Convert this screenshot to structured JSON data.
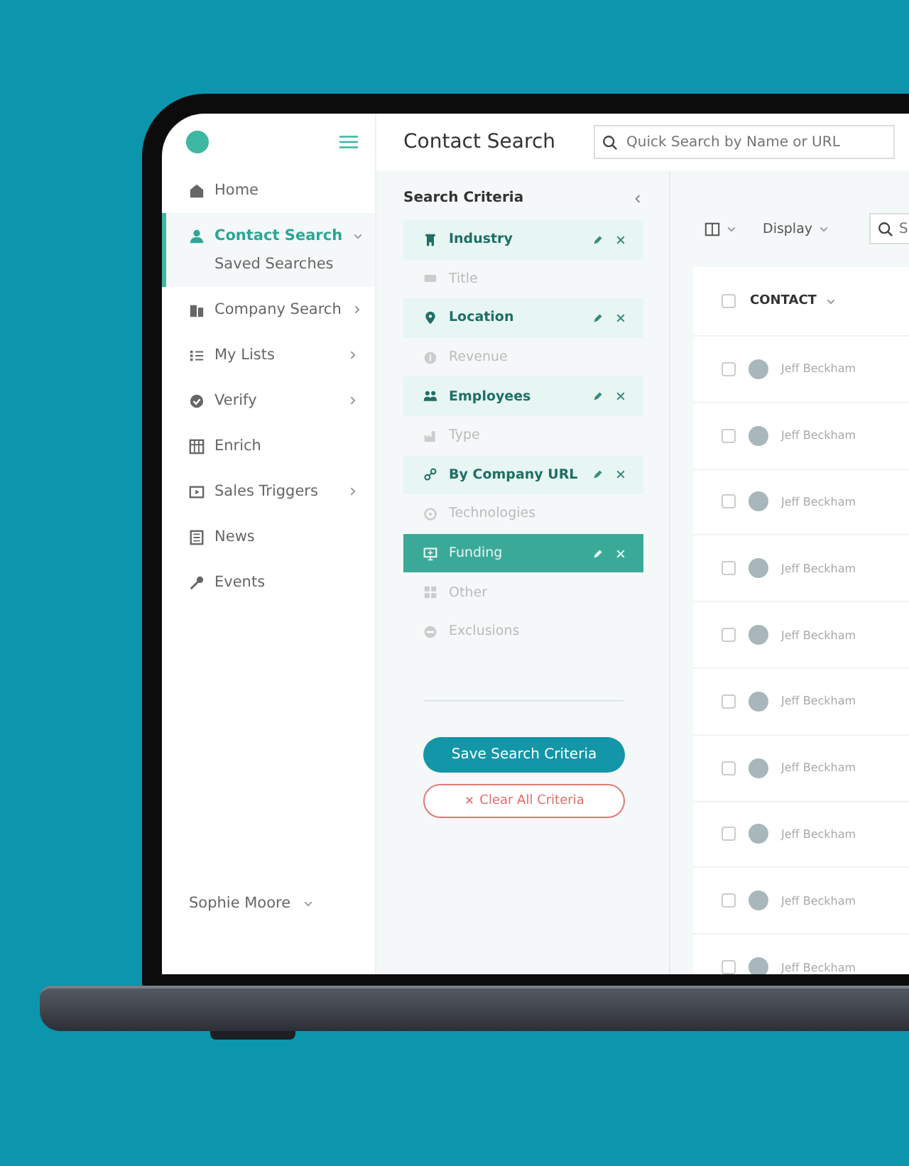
{
  "header": {
    "title": "Contact Search",
    "search": {
      "placeholder": "Quick Search by Name or URL"
    }
  },
  "sidebar": {
    "items": [
      {
        "label": "Home",
        "kind": "link",
        "selected": false
      },
      {
        "label": "Contact Search",
        "kind": "group",
        "selected": true,
        "expanded": true,
        "children": [
          {
            "label": "Saved Searches",
            "selected": false
          }
        ]
      },
      {
        "label": "Company Search",
        "kind": "group",
        "selected": false,
        "expanded": false
      },
      {
        "label": "My Lists",
        "kind": "group",
        "selected": false,
        "expanded": false
      },
      {
        "label": "Verify",
        "kind": "group",
        "selected": false,
        "expanded": false
      },
      {
        "label": "Enrich",
        "kind": "link",
        "selected": false
      },
      {
        "label": "Sales Triggers",
        "kind": "group",
        "selected": false,
        "expanded": false
      },
      {
        "label": "News",
        "kind": "link",
        "selected": false
      },
      {
        "label": "Events",
        "kind": "link",
        "selected": false
      }
    ],
    "user": "Sophie Moore"
  },
  "criteria": {
    "title": "Search Criteria",
    "items": [
      {
        "label": "Industry",
        "active": true,
        "selected": false
      },
      {
        "label": "Title",
        "active": false,
        "selected": false
      },
      {
        "label": "Location",
        "active": true,
        "selected": false
      },
      {
        "label": "Revenue",
        "active": false,
        "selected": false
      },
      {
        "label": "Employees",
        "active": true,
        "selected": false
      },
      {
        "label": "Type",
        "active": false,
        "selected": false
      },
      {
        "label": "By Company URL",
        "active": true,
        "selected": false
      },
      {
        "label": "Technologies",
        "active": false,
        "selected": false
      },
      {
        "label": "Funding",
        "active": true,
        "selected": true
      },
      {
        "label": "Other",
        "active": false,
        "selected": false
      },
      {
        "label": "Exclusions",
        "active": false,
        "selected": false
      }
    ],
    "save_button": "Save Search Criteria",
    "clear_button": "Clear All Criteria"
  },
  "results": {
    "display_label": "Display",
    "search": {
      "placeholder": "S"
    },
    "column": "CONTACT",
    "select_all_checked": false,
    "rows": [
      {
        "name": "Jeff Beckham",
        "checked": false
      },
      {
        "name": "Jeff Beckham",
        "checked": false
      },
      {
        "name": "Jeff Beckham",
        "checked": false
      },
      {
        "name": "Jeff Beckham",
        "checked": false
      },
      {
        "name": "Jeff Beckham",
        "checked": false
      },
      {
        "name": "Jeff Beckham",
        "checked": false
      },
      {
        "name": "Jeff Beckham",
        "checked": false
      },
      {
        "name": "Jeff Beckham",
        "checked": false
      },
      {
        "name": "Jeff Beckham",
        "checked": false
      },
      {
        "name": "Jeff Beckham",
        "checked": false
      }
    ]
  }
}
